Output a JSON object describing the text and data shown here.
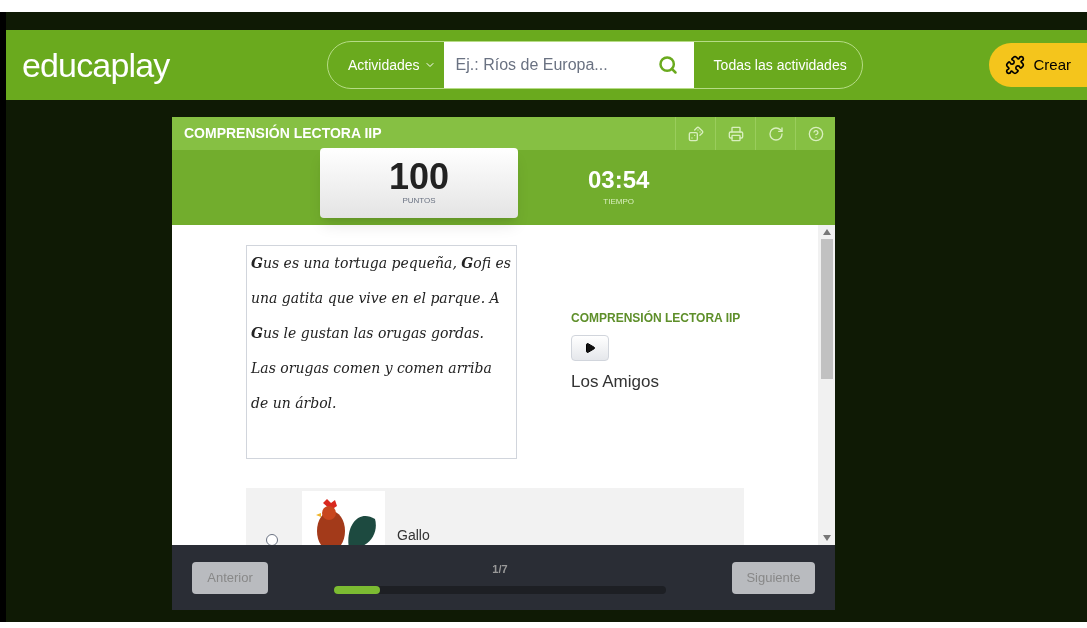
{
  "header": {
    "logo": "educaplay",
    "category": "Actividades",
    "search": {
      "placeholder": "Ej.: Ríos de Europa..."
    },
    "all_link": "Todas las actividades",
    "create_button": "Crear"
  },
  "activity": {
    "title": "COMPRENSIÓN LECTORA IIP",
    "score": {
      "value": "100",
      "label": "PUNTOS"
    },
    "timer": {
      "value": "03:54",
      "label": "TIEMPO"
    },
    "reading": "**G**us es una tortuga pequeña, **G**ofi es una gatita que vive en el parque. A **G**us le gustan las orugas gordas. Las orugas comen y comen arriba de un árbol.",
    "question": {
      "title": "COMPRENSIÓN LECTORA IIP",
      "text": "Los Amigos"
    },
    "options": [
      {
        "label": "Gallo",
        "selected": false
      }
    ],
    "footer": {
      "prev": "Anterior",
      "next": "Siguiente",
      "counter": "1/7",
      "level": 0.14
    }
  }
}
